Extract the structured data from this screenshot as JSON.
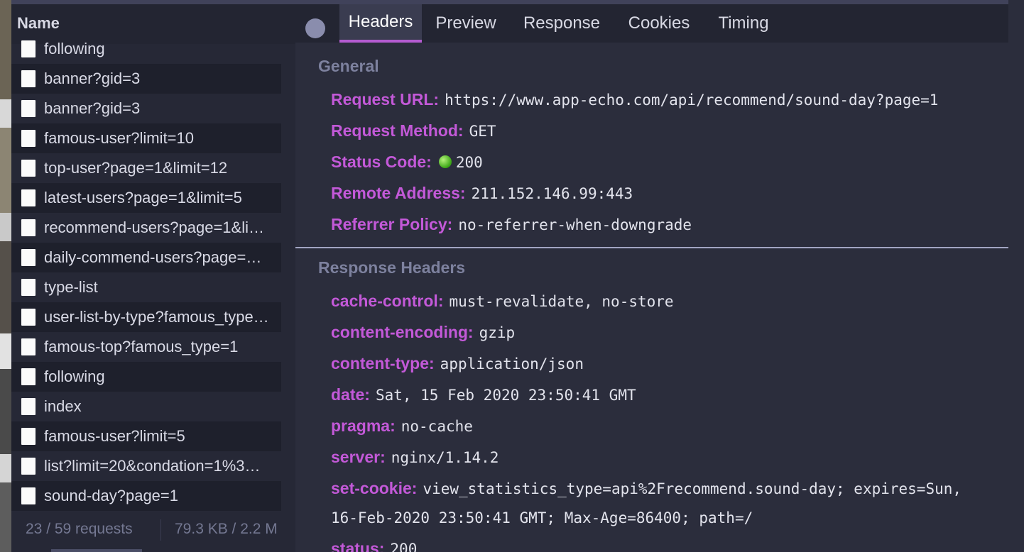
{
  "name_column": {
    "header": "Name",
    "requests": [
      "following",
      "banner?gid=3",
      "banner?gid=3",
      "famous-user?limit=10",
      "top-user?page=1&limit=12",
      "latest-users?page=1&limit=5",
      "recommend-users?page=1&li…",
      "daily-commend-users?page=…",
      "type-list",
      "user-list-by-type?famous_type…",
      "famous-top?famous_type=1",
      "following",
      "index",
      "famous-user?limit=5",
      "list?limit=20&condation=1%3…",
      "sound-day?page=1"
    ]
  },
  "status_bar": {
    "count": "23 / 59 requests",
    "size": "79.3 KB / 2.2 M"
  },
  "tabs": [
    "Headers",
    "Preview",
    "Response",
    "Cookies",
    "Timing"
  ],
  "active_tab": "Headers",
  "general": {
    "title": "General",
    "request_url_key": "Request URL:",
    "request_url": "https://www.app-echo.com/api/recommend/sound-day?page=1",
    "request_method_key": "Request Method:",
    "request_method": "GET",
    "status_code_key": "Status Code:",
    "status_code": "200",
    "remote_address_key": "Remote Address:",
    "remote_address": "211.152.146.99:443",
    "referrer_policy_key": "Referrer Policy:",
    "referrer_policy": "no-referrer-when-downgrade"
  },
  "response_headers": {
    "title": "Response Headers",
    "items": [
      {
        "key": "cache-control:",
        "value": "must-revalidate, no-store"
      },
      {
        "key": "content-encoding:",
        "value": "gzip"
      },
      {
        "key": "content-type:",
        "value": "application/json"
      },
      {
        "key": "date:",
        "value": "Sat, 15 Feb 2020 23:50:41 GMT"
      },
      {
        "key": "pragma:",
        "value": "no-cache"
      },
      {
        "key": "server:",
        "value": "nginx/1.14.2"
      },
      {
        "key": "set-cookie:",
        "value": "view_statistics_type=api%2Frecommend.sound-day; expires=Sun,"
      },
      {
        "key": "status:",
        "value": "200"
      }
    ],
    "set_cookie_continuation": "16-Feb-2020 23:50:41 GMT; Max-Age=86400; path=/"
  },
  "colors": {
    "accent": "#b45bd0",
    "key_color": "#c359d8",
    "status_ok": "#3aa515"
  }
}
